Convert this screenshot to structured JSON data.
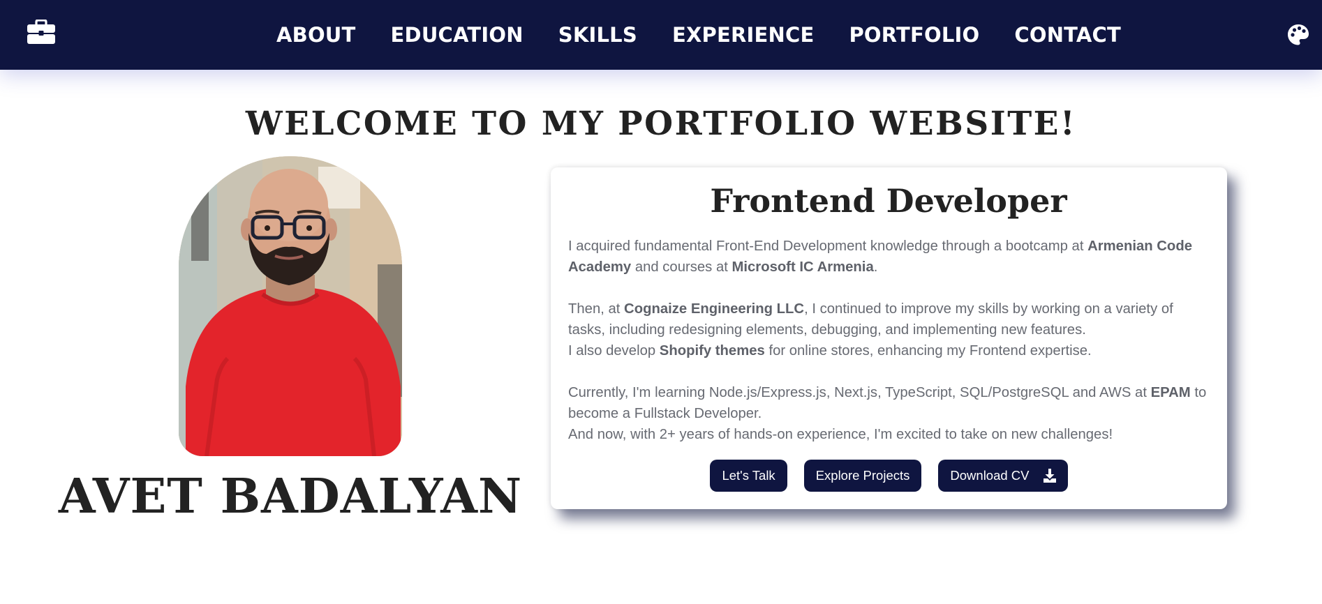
{
  "nav": {
    "brand_icon": "briefcase-icon",
    "links": [
      {
        "label": "ABOUT"
      },
      {
        "label": "EDUCATION"
      },
      {
        "label": "SKILLS"
      },
      {
        "label": "EXPERIENCE"
      },
      {
        "label": "PORTFOLIO"
      },
      {
        "label": "CONTACT"
      }
    ],
    "theme_icon": "palette-icon"
  },
  "hero": {
    "welcome": "WELCOME TO MY PORTFOLIO WEBSITE!",
    "name": "AVET BADALYAN"
  },
  "card": {
    "title": "Frontend Developer",
    "p1": {
      "t1": "I acquired fundamental Front-End Development knowledge through a bootcamp at ",
      "b1": "Armenian Code Academy",
      "t2": " and courses at ",
      "b2": "Microsoft IC Armenia",
      "t3": "."
    },
    "p2": {
      "t1": "Then, at ",
      "b1": "Cognaize Engineering LLC",
      "t2": ", I continued to improve my skills by working on a variety of tasks, including redesigning elements, debugging, and implementing new features."
    },
    "p3": {
      "t1": "I also develop ",
      "b1": "Shopify themes",
      "t2": " for online stores, enhancing my Frontend expertise."
    },
    "p4": {
      "t1": "Currently, I'm learning Node.js/Express.js, Next.js, TypeScript, SQL/PostgreSQL and AWS at ",
      "b1": "EPAM",
      "t2": " to become a Fullstack Developer."
    },
    "p5": "And now, with 2+ years of hands-on experience, I'm excited to take on new challenges!",
    "buttons": {
      "talk": "Let's Talk",
      "projects": "Explore Projects",
      "cv": "Download CV"
    },
    "download_icon": "download-icon"
  },
  "colors": {
    "nav_bg": "#0f1540",
    "button_bg": "#0f1540",
    "heading": "#222222",
    "body_text": "#676a72",
    "shirt_red": "#e3242b"
  }
}
